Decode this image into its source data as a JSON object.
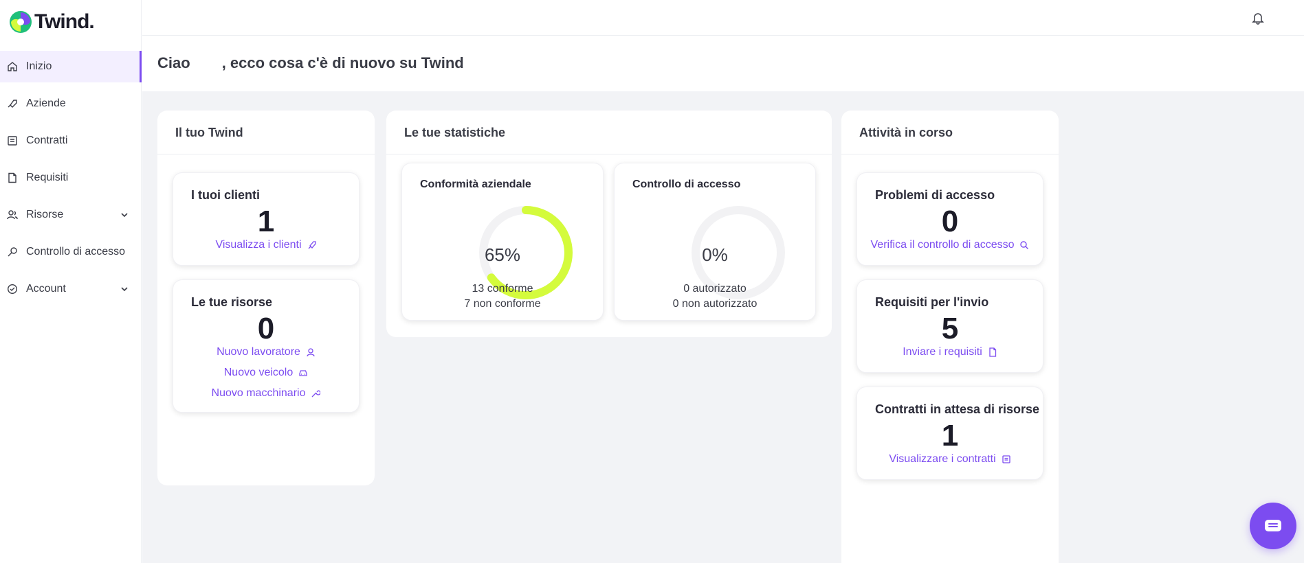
{
  "brand": {
    "name": "Twind.",
    "primary_color": "#7c4cf0",
    "accent_color": "#d4fb3c"
  },
  "sidebar": {
    "items": [
      {
        "label": "Inizio",
        "icon": "home-icon",
        "active": true
      },
      {
        "label": "Aziende",
        "icon": "handshake-icon"
      },
      {
        "label": "Contratti",
        "icon": "contract-icon"
      },
      {
        "label": "Requisiti",
        "icon": "document-icon"
      },
      {
        "label": "Risorse",
        "icon": "users-icon",
        "expandable": true
      },
      {
        "label": "Controllo di accesso",
        "icon": "key-icon"
      },
      {
        "label": "Account",
        "icon": "account-icon",
        "expandable": true
      }
    ]
  },
  "greeting": {
    "hello": "Ciao",
    "rest": ", ecco cosa c'è di nuovo su Twind"
  },
  "panels": {
    "twind": {
      "title": "Il tuo Twind",
      "clients": {
        "title": "I tuoi clienti",
        "value": "1",
        "link": "Visualizza i clienti"
      },
      "resources": {
        "title": "Le tue risorse",
        "value": "0",
        "links": [
          "Nuovo lavoratore",
          "Nuovo veicolo",
          "Nuovo macchinario"
        ]
      }
    },
    "stats": {
      "title": "Le tue statistiche",
      "compliance": {
        "title": "Conformità aziendale",
        "percent_label": "65%",
        "percent": 65,
        "line1": "13 conforme",
        "line2": "7 non conforme"
      },
      "access": {
        "title": "Controllo di accesso",
        "percent_label": "0%",
        "percent": 0,
        "line1": "0 autorizzato",
        "line2": "0 non autorizzato"
      }
    },
    "activities": {
      "title": "Attività in corso",
      "access_problems": {
        "title": "Problemi di accesso",
        "value": "0",
        "link": "Verifica il controllo di accesso"
      },
      "requirements": {
        "title": "Requisiti per l'invio",
        "value": "5",
        "link": "Inviare i requisiti"
      },
      "contracts": {
        "title": "Contratti in attesa di risorse",
        "value": "1",
        "link": "Visualizzare i contratti"
      }
    }
  }
}
